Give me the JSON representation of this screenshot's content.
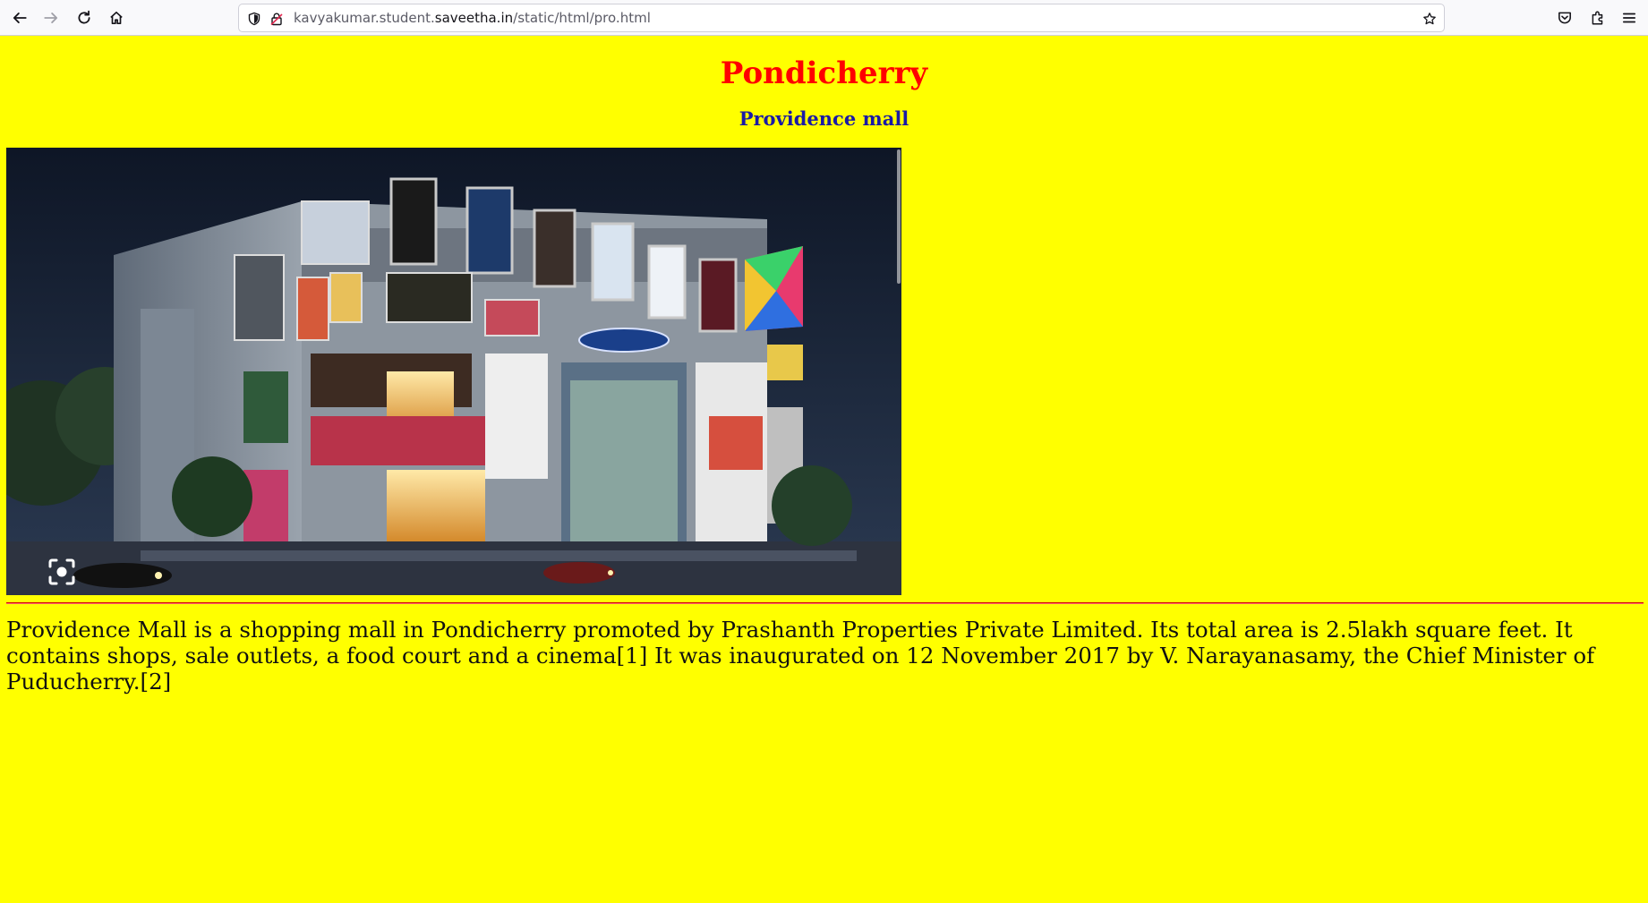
{
  "browser": {
    "url_prefix": "kavyakumar.student.",
    "url_domain": "saveetha.in",
    "url_path": "/static/html/pro.html",
    "icons": [
      "back-arrow-icon",
      "forward-arrow-icon",
      "reload-icon",
      "home-icon",
      "shield-icon",
      "lock-icon",
      "star-icon",
      "pocket-icon",
      "extensions-icon",
      "menu-icon"
    ]
  },
  "page": {
    "title": "Pondicherry",
    "subtitle": "Providence mall",
    "photo_alt": "Providence Mall",
    "description": "Providence Mall is a shopping mall in Pondicherry promoted by Prashanth Properties Private Limited. Its total area is 2.5lakh square feet. It contains shops, sale outlets, a food court and a cinema[1] It was inaugurated on 12 November 2017 by V. Narayanasamy, the Chief Minister of Puducherry.[2]"
  },
  "colors": {
    "background": "#ffff00",
    "title": "#ff0000",
    "subtitle": "#1a1aa6",
    "divider": "#d40000"
  }
}
